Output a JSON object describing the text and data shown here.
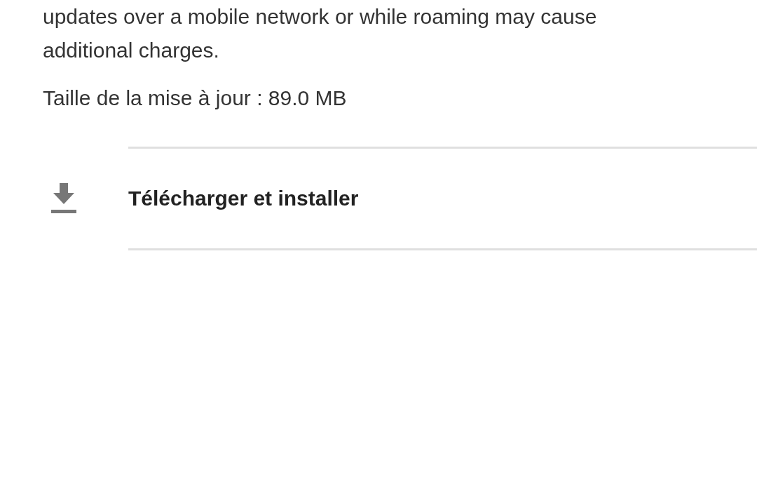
{
  "description": "updates over a mobile network or while roaming may cause additional charges.",
  "update_size": "Taille de la mise à jour : 89.0 MB",
  "actions": [
    {
      "kind": "download",
      "label": "Télécharger et installer"
    }
  ]
}
